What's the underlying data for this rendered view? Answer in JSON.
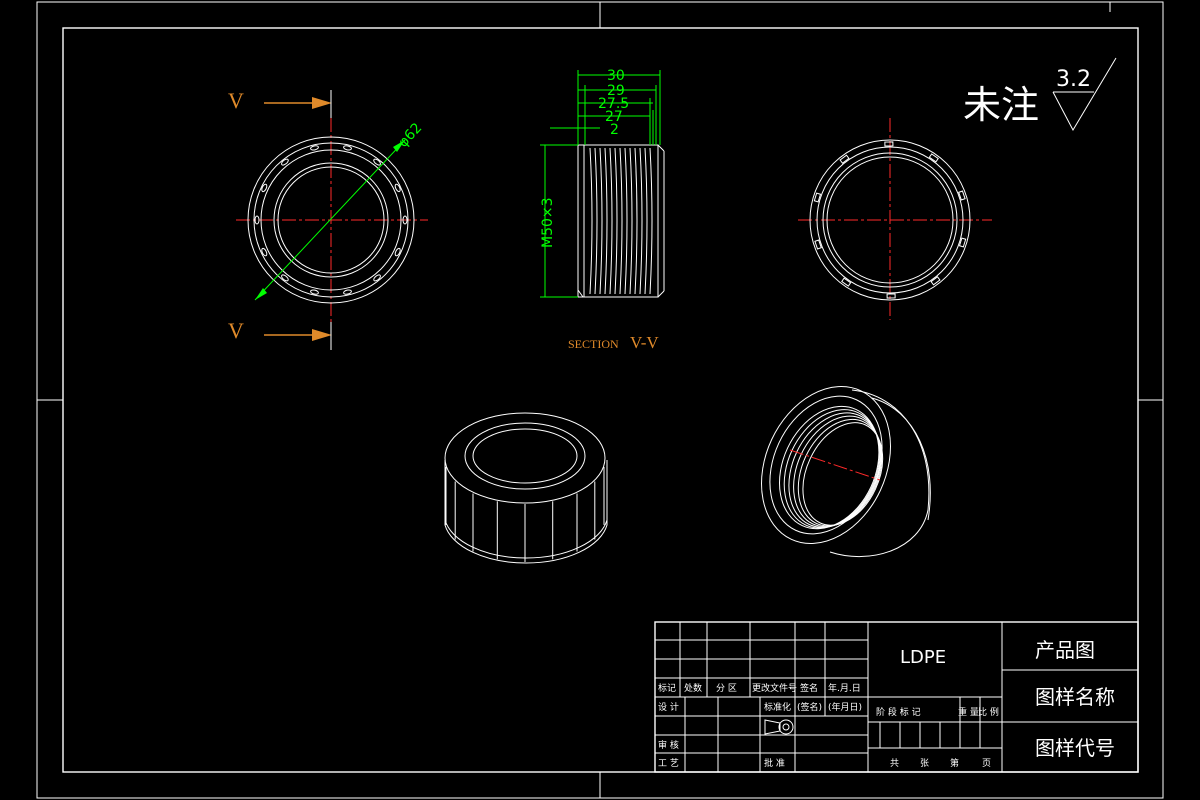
{
  "note": {
    "text": "未注",
    "roughness": "3.2"
  },
  "section": {
    "cut_label_top": "V",
    "cut_label_bottom": "V",
    "caption_prefix": "SECTION",
    "caption_name": "V-V"
  },
  "dims": {
    "diameter": "φ62",
    "thread": "M50×3",
    "lengths": [
      "30",
      "29",
      "27.5",
      "27",
      "2"
    ]
  },
  "title_block": {
    "material": "LDPE",
    "product": "产品图",
    "drawing_name": "图样名称",
    "drawing_code": "图样代号",
    "rev_headers": [
      "标记",
      "处数",
      "分 区",
      "更改文件号",
      "签名",
      "年.月.日"
    ],
    "row_design": "设 计",
    "row_std": "标准化",
    "row_sign": "(签名)",
    "row_date": "(年月日)",
    "row_review": "审 核",
    "row_process": "工 艺",
    "row_approve": "批 准",
    "stage_headers": [
      "阶 段 标 记",
      "重 量",
      "比 例"
    ],
    "sheet_footer": [
      "共",
      "张",
      "第",
      "页"
    ]
  },
  "colors": {
    "line": "#ffffff",
    "center": "#ff2a2a",
    "dimension": "#00ff00",
    "section": "#e08a2a",
    "background": "#000000"
  }
}
